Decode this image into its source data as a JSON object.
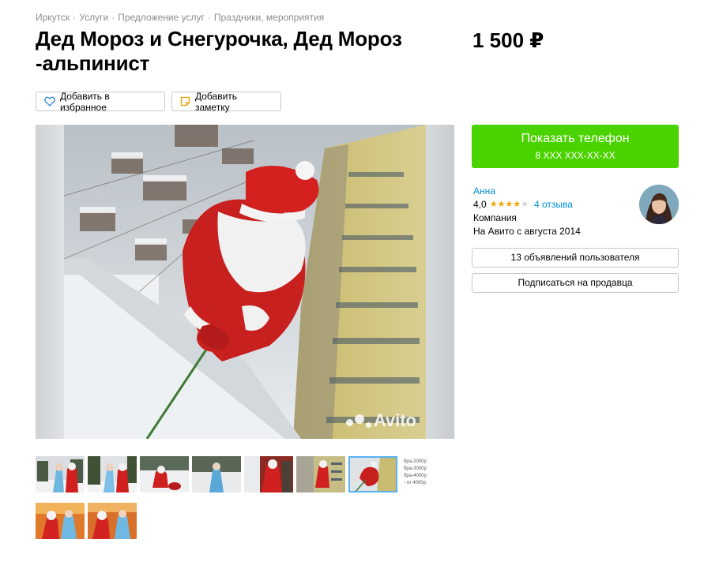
{
  "breadcrumbs": [
    "Иркутск",
    "Услуги",
    "Предложение услуг",
    "Праздники, мероприятия"
  ],
  "breadcrumb_separator": "·",
  "listing": {
    "title": "Дед Мороз и Снегурочка, Дед Мороз -альпинист",
    "price": "1 500 ₽"
  },
  "actions": {
    "favorite_label": "Добавить в избранное",
    "favorite_icon": "heart-icon",
    "note_label": "Добавить заметку",
    "note_icon": "note-icon"
  },
  "gallery": {
    "watermark": "Avito",
    "thumbnail_count": 10,
    "selected_thumbnail": 7,
    "price_list_thumb_lines": [
      "бра-2000р",
      "бра-3000р",
      "бра-4000р",
      "- от 4000р"
    ]
  },
  "contact": {
    "button_label": "Показать телефон",
    "phone_masked": "8 XXX XXX-XX-XX"
  },
  "seller": {
    "name": "Анна",
    "rating": "4,0",
    "rating_stars": 4,
    "reviews": "4 отзыва",
    "type": "Компания",
    "since": "На Авито с августа 2014",
    "listings_button": "13 объявлений пользователя",
    "subscribe_button": "Подписаться на продавца"
  },
  "colors": {
    "call_button": "#4bd300",
    "link": "#0091d9",
    "star": "#f2a400",
    "selected_thumb_outline": "#58b2f2"
  }
}
